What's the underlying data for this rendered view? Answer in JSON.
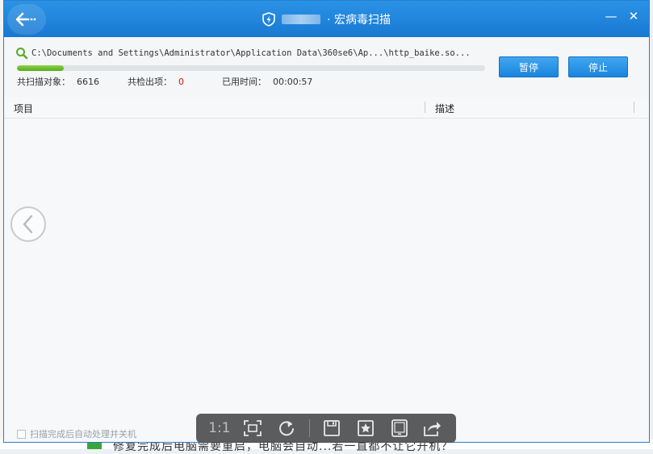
{
  "window": {
    "title": "· 宏病毒扫描",
    "back_icon": "back-arrow-icon",
    "shield_icon": "shield-icon",
    "min_label": "—",
    "close_label": "✕"
  },
  "scan": {
    "current_path": "C:\\Documents and Settings\\Administrator\\Application Data\\360se6\\Ap...\\http_baike.so...",
    "progress_fraction": 0.1,
    "objects_label": "共扫描对象：",
    "objects_value": "6616",
    "found_label": "共检出项：",
    "found_value": "0",
    "time_label": "已用时间：",
    "time_value": "00:00:57",
    "pause_label": "暂停",
    "stop_label": "停止"
  },
  "table": {
    "col_item": "项目",
    "col_desc": "描述"
  },
  "footer": {
    "auto_shutdown_label": "扫描完成后自动处理并关机"
  },
  "viewer": {
    "actual_size_label": "1:1",
    "icons": [
      "fit-screen-icon",
      "rotate-icon",
      "save-icon",
      "favorite-icon",
      "tablet-icon",
      "share-icon"
    ]
  },
  "background": {
    "partial_text": "修复完成后电脑需要重启，电脑会自动...若一直都不让它开机？"
  },
  "colors": {
    "titlebar": "#1f86dc",
    "button": "#2a93e6",
    "progress": "#6fc030",
    "found_value": "#d11111"
  }
}
